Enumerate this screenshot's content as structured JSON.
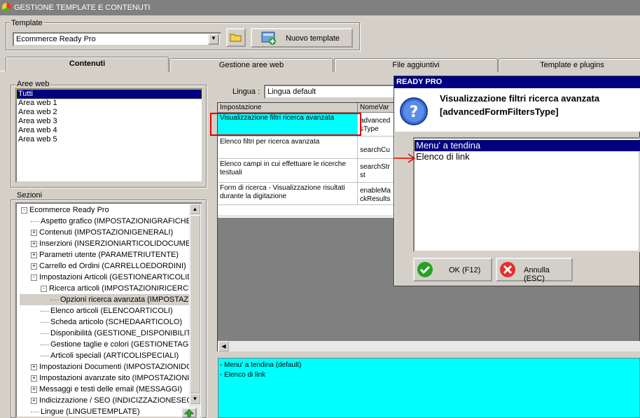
{
  "window": {
    "title": "GESTIONE TEMPLATE E CONTENUTI"
  },
  "template": {
    "group_label": "Template",
    "selected": "Ecommerce Ready Pro",
    "new_button": "Nuovo template"
  },
  "tabs": [
    {
      "label": "Contenuti"
    },
    {
      "label": "Gestione aree web"
    },
    {
      "label": "File aggiuntivi"
    },
    {
      "label": "Template e plugins"
    }
  ],
  "aree_web": {
    "label": "Aree web",
    "items": [
      "Tutti",
      "Area web 1",
      "Area web 2",
      "Area web 3",
      "Area web 4",
      "Area web 5"
    ]
  },
  "sezioni": {
    "label": "Sezioni",
    "tree": [
      {
        "text": "Ecommerce Ready Pro",
        "pm": "-"
      },
      {
        "text": "Aspetto grafico (IMPOSTAZIONIGRAFICHE)",
        "pm": ""
      },
      {
        "text": "Contenuti (IMPOSTAZIONIGENERALI)",
        "pm": "+"
      },
      {
        "text": "Inserzioni (INSERZIONIARTICOLIDOCUMEN",
        "pm": "+"
      },
      {
        "text": "Parametri utente (PARAMETRIUTENTE)",
        "pm": "+"
      },
      {
        "text": "Carrello ed Ordini (CARRELLOEDORDINI)",
        "pm": "+"
      },
      {
        "text": "Impostazioni Articoli (GESTIONEARTICOLIDO",
        "pm": "-"
      },
      {
        "text": "Ricerca articoli (IMPOSTAZIONIRICERCH",
        "pm": "-"
      },
      {
        "text": "Opzioni ricerca avanzata (IMPOSTAZIO",
        "pm": ""
      },
      {
        "text": "Elenco articoli (ELENCOARTICOLI)",
        "pm": ""
      },
      {
        "text": "Scheda articolo (SCHEDAARTICOLO)",
        "pm": ""
      },
      {
        "text": "Disponibilità (GESTIONE_DISPONIBILITA",
        "pm": ""
      },
      {
        "text": "Gestione taglie e colori (GESTIONETAGLI",
        "pm": ""
      },
      {
        "text": "Articoli speciali (ARTICOLISPECIALI)",
        "pm": ""
      },
      {
        "text": "Impostazioni Documenti (IMPOSTAZIONIDOC",
        "pm": "+"
      },
      {
        "text": "Impostazioni avanzate sito (IMPOSTAZIONIA",
        "pm": "+"
      },
      {
        "text": "Messaggi e testi delle email (MESSAGGI)",
        "pm": "+"
      },
      {
        "text": "Indicizzazione / SEO (INDICIZZAZIONESEO",
        "pm": "+"
      },
      {
        "text": "Lingue (LINGUETEMPLATE)",
        "pm": ""
      }
    ]
  },
  "lingua": {
    "label": "Lingua :",
    "value": "Lingua default"
  },
  "grid": {
    "headers": [
      "Impostazione",
      "NomeVar"
    ],
    "rows": [
      {
        "impostazione": "Visualizzazione filtri ricerca avanzata",
        "nomevar": "advancedFormFiltersType"
      },
      {
        "impostazione": "Elenco filtri per ricerca avanzata",
        "nomevar": "searchCu"
      },
      {
        "impostazione": "Elenco campi in cui effettuare le ricerche testuali",
        "nomevar": "searchStrst"
      },
      {
        "impostazione": "Form di ricerca - Visualizzazione risultati durante la digitazione",
        "nomevar": "enableMackResults"
      }
    ]
  },
  "nomevar_display": [
    [
      "advanced",
      "sType"
    ],
    [
      "searchCu"
    ],
    [
      "searchStr",
      "st"
    ],
    [
      "enableMa",
      "ckResults"
    ]
  ],
  "description": [
    "- Menu' a tendina (default)",
    "- Elenco di link"
  ],
  "dialog": {
    "title": "READY PRO",
    "heading_line1": "Visualizzazione filtri ricerca avanzata",
    "heading_line2": "[advancedFormFiltersType]",
    "options": [
      "Menu' a tendina",
      "Elenco di link"
    ],
    "ok": "OK (F12)",
    "cancel": "Annulla (ESC)"
  },
  "colors": {
    "highlight": "#00ffff",
    "selection": "#000080",
    "annotation": "#ff0000"
  }
}
